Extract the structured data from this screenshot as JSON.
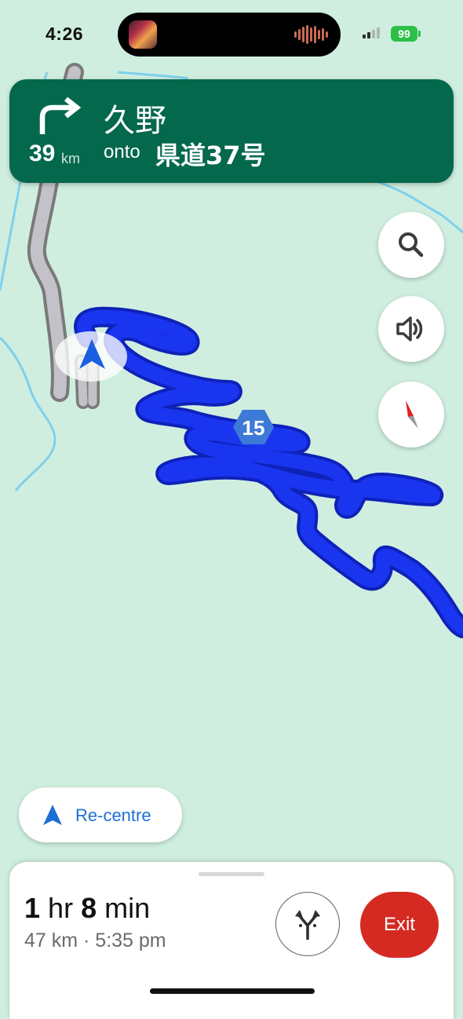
{
  "status_bar": {
    "time": "4:26",
    "battery": "99",
    "battery_color": "#2ebf48"
  },
  "navigation": {
    "turn_direction": "turn-right-icon",
    "distance_value": "39",
    "distance_unit": "km",
    "street_name": "久野",
    "onto_label": "onto",
    "onto_road": "県道37号"
  },
  "map": {
    "route_color": "#1a35f0",
    "background_color": "#cfeedf",
    "route_shield": "15"
  },
  "controls": {
    "search_icon": "search-icon",
    "sound_icon": "speaker-icon",
    "compass_icon": "compass-icon",
    "recentre_label": "Re-centre"
  },
  "trip": {
    "duration_hours": "1",
    "duration_hours_unit": "hr",
    "duration_minutes": "8",
    "duration_minutes_unit": "min",
    "summary": "47 km · 5:35 pm",
    "exit_label": "Exit",
    "exit_color": "#d52a22"
  }
}
